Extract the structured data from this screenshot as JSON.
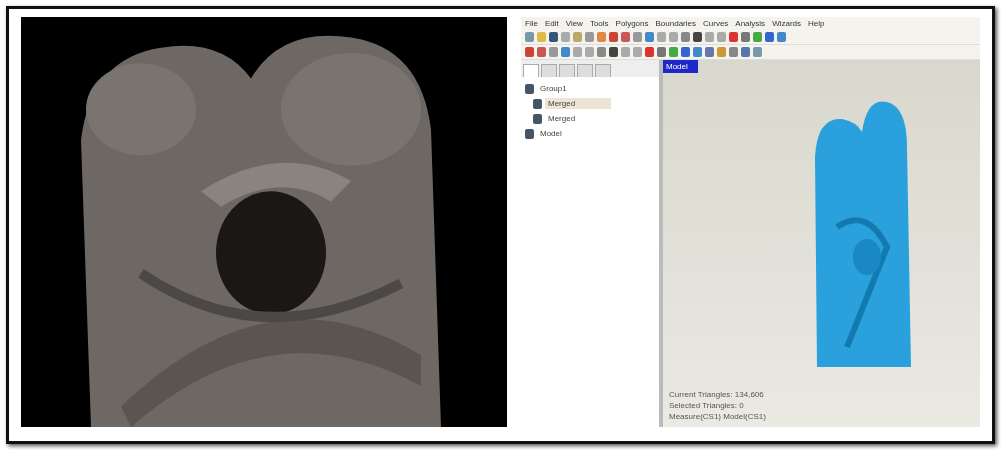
{
  "app": {
    "menu": [
      "File",
      "Edit",
      "View",
      "Tools",
      "Polygons",
      "Boundaries",
      "Curves",
      "Analysis",
      "Wizards",
      "Help"
    ],
    "panel_tabs": [
      {
        "selected": true
      },
      {
        "selected": false
      },
      {
        "selected": false
      },
      {
        "selected": false
      },
      {
        "selected": false
      }
    ],
    "tree": [
      {
        "label": "Group1",
        "selected": false,
        "children": [
          {
            "label": "Merged",
            "selected": true
          },
          {
            "label": "Merged",
            "selected": false
          }
        ]
      },
      {
        "label": "Model",
        "selected": false
      }
    ],
    "viewport_tab": "Model",
    "status": [
      "Current Triangles: 134,606",
      "Selected Triangles: 0",
      "Measure(CS1) Model(CS1)"
    ]
  }
}
